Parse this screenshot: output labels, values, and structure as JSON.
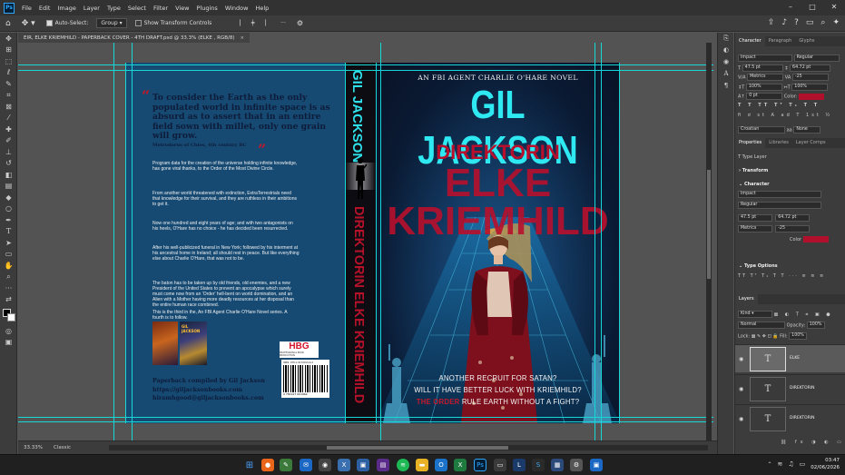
{
  "menu": {
    "app_icon": "Ps",
    "items": [
      "File",
      "Edit",
      "Image",
      "Layer",
      "Type",
      "Select",
      "Filter",
      "View",
      "Plugins",
      "Window",
      "Help"
    ]
  },
  "options_bar": {
    "auto_select_label": "Auto-Select:",
    "auto_select_value": "Group",
    "transform_controls_label": "Show Transform Controls"
  },
  "document_tab": {
    "title": "EIR, ELKE KRIEMHILD - PAPERBACK COVER - 4TH DRAFT.psd @ 33.3% (ELKE , RGB/8)",
    "close": "×"
  },
  "back_cover": {
    "quote_open": "“",
    "quote_close": "”",
    "quote": "To consider the Earth as the only populated world in infinite space is as absurd as to assert that in an entire field sown with millet, only one grain will grow.",
    "quote_attribution": "Metrodorus of Chios, 4th century BC",
    "blurb": [
      "Program data for the creation of the universe holding infinite knowledge, has gone viral thanks, to the Order of the Most Divine Circle.",
      "From another world threatened with extinction, ExtraTerrestrials need that knowledge for their survival, and they are ruthless in their ambitions to get it.",
      "Now one hundred and eight years of age; and with two antagonists on his heels, O'Hare has no choice - he has decided been resurrected.",
      "After his well-publicized funeral in New York; followed by his interment at his ancestral home in Ireland; all should rest in peace. But like everything else about Charlie O'Hare, that was not to be.",
      "The baton has to be taken up by old friends, old enemies, and a new President of the United States to prevent an apocalypse which surely must come now from an 'Order' hell-bent on world domination, and an Alien with a Mother having more deadly resources at her disposal than the entire human race combined.",
      "This is the third in the, An FBI Agent Charlie O'Hare Novel series. A fourth is to follow."
    ],
    "thumb1_label": "",
    "thumb2_label": "GIL JACKSON",
    "contact": [
      "Paperback compiled by Gil Jackson",
      "https://giljacksonbooks.com",
      "hiramhgood@giljacksonbooks.com"
    ],
    "logo_text": "HBG",
    "logo_sub": "PROFESSIONAL BOOK PRODUCTION",
    "isbn_text": "ISBN: 978-1-9170019-6-2",
    "barcode_digits": "9 781917 001962"
  },
  "spine": {
    "author": "GIL JACKSON",
    "title": "DIREKTORIN ELKE KRIEMHILD"
  },
  "front_cover": {
    "series": "AN FBI AGENT CHARLIE O'HARE NOVEL",
    "author": "GIL JACKSON",
    "title1": "DIREKTORIN",
    "title2": "ELKE",
    "title3": "KRIEMHILD",
    "tagline1": "ANOTHER RECRUIT FOR SATAN?",
    "tagline2": "WILL IT HAVE BETTER LUCK WITH KRIEMHILD?",
    "tagline3_red": "THE ORDER",
    "tagline3_rest": " RULE EARTH WITHOUT A FIGHT?"
  },
  "character_panel": {
    "tabs": [
      "Character",
      "Paragraph",
      "Glyphs"
    ],
    "font": "Impact",
    "style": "Regular",
    "size": "47.5 pt",
    "leading": "64.72 pt",
    "kerning": "Metrics",
    "tracking": "-25",
    "vscale": "100%",
    "hscale": "100%",
    "baseline": "0 pt",
    "color_label": "Color:",
    "color": "#b0102c",
    "lang": "Croatian",
    "aa": "None"
  },
  "properties_panel": {
    "tabs": [
      "Properties",
      "Libraries",
      "Layer Comps"
    ],
    "layer_kind": "Type Layer",
    "transform": "Transform",
    "character": "Character",
    "font": "Impact",
    "style": "Regular",
    "size": "47.5 pt",
    "leading": "64.72 pt",
    "kerning": "Metrics",
    "tracking": "-25",
    "color_label": "Color",
    "type_options": "Type Options"
  },
  "layers_panel": {
    "tab": "Layers",
    "kind": "Kind",
    "blend": "Normal",
    "opacity_label": "Opacity:",
    "opacity": "100%",
    "lock_label": "Lock:",
    "fill_label": "Fill:",
    "fill": "100%",
    "layers": [
      "ELKE",
      "DIREKTORIN",
      "DIREKTORIN"
    ]
  },
  "status": {
    "zoom": "33.33%",
    "mode": "Classic"
  },
  "taskbar": {
    "time": "03:47",
    "date": "02/06/2026"
  }
}
